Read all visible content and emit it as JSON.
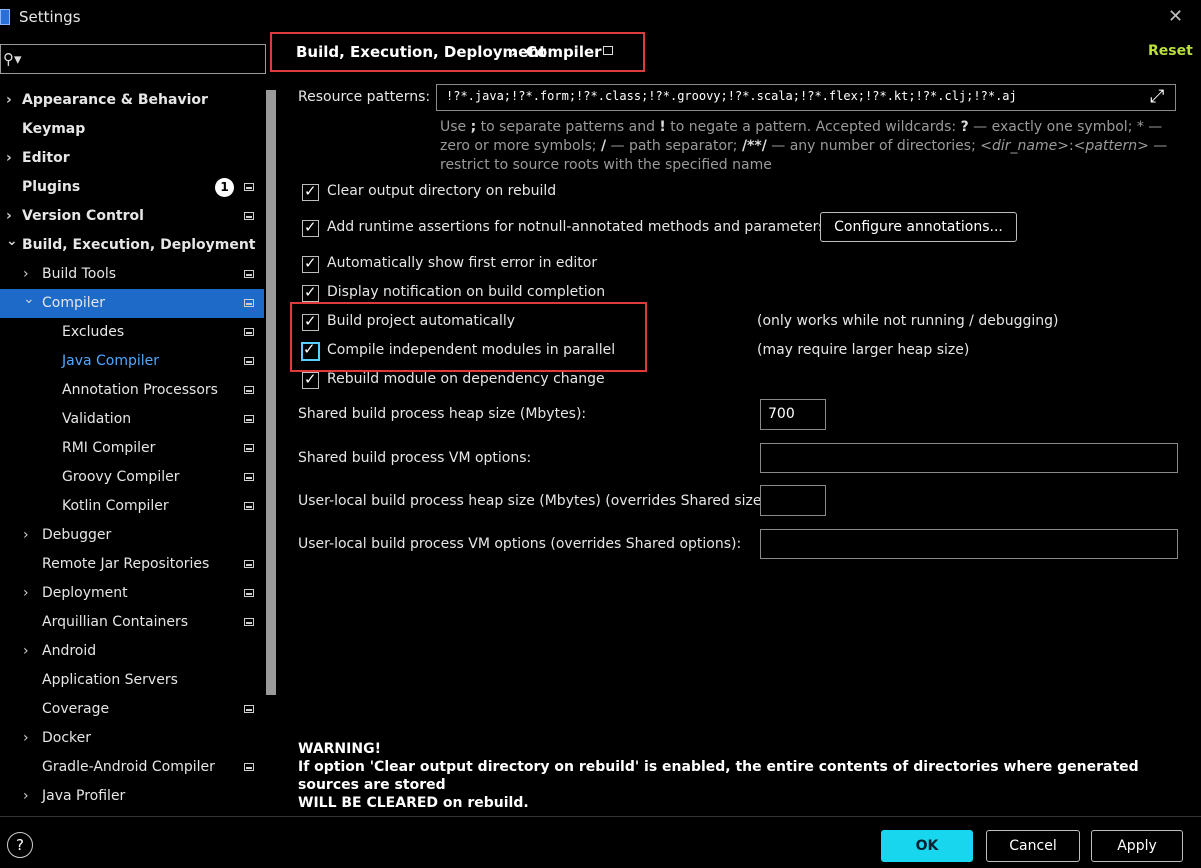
{
  "window": {
    "title": "Settings"
  },
  "search": {
    "placeholder": ""
  },
  "sidebar": {
    "items": [
      {
        "label": "Appearance & Behavior",
        "bold": true,
        "chevron": ">",
        "level": 0,
        "project": false
      },
      {
        "label": "Keymap",
        "bold": true,
        "chevron": "",
        "level": 0,
        "project": false
      },
      {
        "label": "Editor",
        "bold": true,
        "chevron": ">",
        "level": 0,
        "project": false
      },
      {
        "label": "Plugins",
        "bold": true,
        "chevron": "",
        "level": 0,
        "project": true,
        "badge": "1"
      },
      {
        "label": "Version Control",
        "bold": true,
        "chevron": ">",
        "level": 0,
        "project": true
      },
      {
        "label": "Build, Execution, Deployment",
        "bold": true,
        "chevron": "v",
        "level": 0,
        "project": false
      },
      {
        "label": "Build Tools",
        "bold": false,
        "chevron": ">",
        "level": 1,
        "project": true
      },
      {
        "label": "Compiler",
        "bold": false,
        "chevron": "v",
        "level": 1,
        "project": true,
        "selected": true
      },
      {
        "label": "Excludes",
        "bold": false,
        "chevron": "",
        "level": 2,
        "project": true
      },
      {
        "label": "Java Compiler",
        "bold": false,
        "chevron": "",
        "level": 2,
        "project": true,
        "link": true
      },
      {
        "label": "Annotation Processors",
        "bold": false,
        "chevron": "",
        "level": 2,
        "project": true
      },
      {
        "label": "Validation",
        "bold": false,
        "chevron": "",
        "level": 2,
        "project": true
      },
      {
        "label": "RMI Compiler",
        "bold": false,
        "chevron": "",
        "level": 2,
        "project": true
      },
      {
        "label": "Groovy Compiler",
        "bold": false,
        "chevron": "",
        "level": 2,
        "project": true
      },
      {
        "label": "Kotlin Compiler",
        "bold": false,
        "chevron": "",
        "level": 2,
        "project": true
      },
      {
        "label": "Debugger",
        "bold": false,
        "chevron": ">",
        "level": 1,
        "project": false
      },
      {
        "label": "Remote Jar Repositories",
        "bold": false,
        "chevron": "",
        "level": 1,
        "project": true
      },
      {
        "label": "Deployment",
        "bold": false,
        "chevron": ">",
        "level": 1,
        "project": true
      },
      {
        "label": "Arquillian Containers",
        "bold": false,
        "chevron": "",
        "level": 1,
        "project": true
      },
      {
        "label": "Android",
        "bold": false,
        "chevron": ">",
        "level": 1,
        "project": false
      },
      {
        "label": "Application Servers",
        "bold": false,
        "chevron": "",
        "level": 1,
        "project": false
      },
      {
        "label": "Coverage",
        "bold": false,
        "chevron": "",
        "level": 1,
        "project": true
      },
      {
        "label": "Docker",
        "bold": false,
        "chevron": ">",
        "level": 1,
        "project": false
      },
      {
        "label": "Gradle-Android Compiler",
        "bold": false,
        "chevron": "",
        "level": 1,
        "project": true
      },
      {
        "label": "Java Profiler",
        "bold": false,
        "chevron": ">",
        "level": 1,
        "project": false
      }
    ]
  },
  "header": {
    "crumb1": "Build, Execution, Deployment",
    "separator": "›",
    "crumb2": "Compiler",
    "reset": "Reset"
  },
  "resource": {
    "label": "Resource patterns:",
    "value": "!?*.java;!?*.form;!?*.class;!?*.groovy;!?*.scala;!?*.flex;!?*.kt;!?*.clj;!?*.aj",
    "hint_1": "Use ",
    "hint_semicolon": ";",
    "hint_2": " to separate patterns and ",
    "hint_excl": "!",
    "hint_3": " to negate a pattern. Accepted wildcards: ",
    "hint_q": "?",
    "hint_4": " — exactly one symbol; * — zero or more symbols; ",
    "hint_slash": "/",
    "hint_5": " — path separator; ",
    "hint_dstar": "/**/",
    "hint_6": " — any number of directories; ",
    "hint_dir": "<dir_name>",
    "hint_colon": ":",
    "hint_pattern": "<pattern>",
    "hint_7": " — restrict to source roots with the specified name"
  },
  "options": {
    "clear_output": "Clear output directory on rebuild",
    "runtime_assert": "Add runtime assertions for notnull-annotated methods and parameters",
    "configure_btn": "Configure annotations...",
    "show_error": "Automatically show first error in editor",
    "notify": "Display notification on build completion",
    "build_auto": "Build project automatically",
    "build_auto_note": "(only works while not running / debugging)",
    "parallel": "Compile independent modules in parallel",
    "parallel_note": "(may require larger heap size)",
    "rebuild_dep": "Rebuild module on dependency change"
  },
  "fields": {
    "heap_label": "Shared build process heap size (Mbytes):",
    "heap_value": "700",
    "vm_label": "Shared build process VM options:",
    "vm_value": "",
    "local_heap_label": "User-local build process heap size (Mbytes) (overrides Shared size):",
    "local_heap_value": "",
    "local_vm_label": "User-local build process VM options (overrides Shared options):",
    "local_vm_value": ""
  },
  "warning": {
    "title": "WARNING!",
    "line1": "If option 'Clear output directory on rebuild' is enabled, the entire contents of directories where generated sources are stored",
    "line2": "WILL BE CLEARED on rebuild."
  },
  "footer": {
    "help": "?",
    "ok": "OK",
    "cancel": "Cancel",
    "apply": "Apply"
  },
  "colors": {
    "selection": "#1e6ac9",
    "link": "#52a8ff",
    "reset": "#b9e03c",
    "primary": "#19d6ef",
    "highlight_box": "#e03b3b"
  }
}
